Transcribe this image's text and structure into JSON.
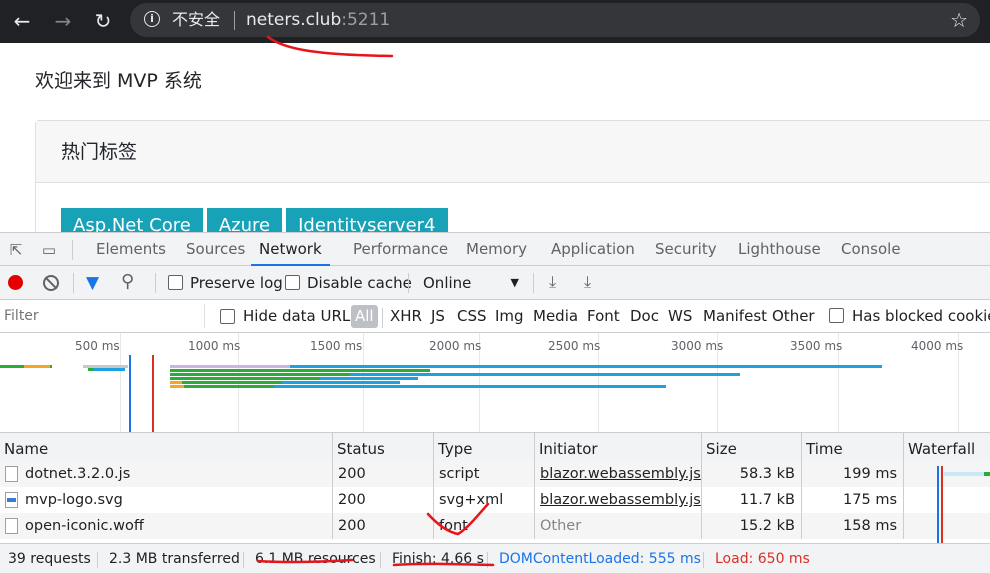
{
  "browser": {
    "security_label": "不安全",
    "url_host": "neters.club",
    "url_port": ":5211"
  },
  "page": {
    "welcome": "欢迎来到 MVP 系统",
    "card_title": "热门标签",
    "tags": [
      "Asp.Net Core",
      "Azure",
      "Identityserver4"
    ]
  },
  "devtools": {
    "tabs": [
      "Elements",
      "Sources",
      "Network",
      "Performance",
      "Memory",
      "Application",
      "Security",
      "Lighthouse",
      "Console"
    ],
    "active_tab": "Network",
    "toolbar": {
      "preserve_log": "Preserve log",
      "disable_cache": "Disable cache",
      "throttle": "Online"
    },
    "filterbar": {
      "placeholder": "Filter",
      "hide_data_urls": "Hide data URLs",
      "types": [
        "All",
        "XHR",
        "JS",
        "CSS",
        "Img",
        "Media",
        "Font",
        "Doc",
        "WS",
        "Manifest",
        "Other"
      ],
      "has_blocked": "Has blocked cookies"
    },
    "overview": {
      "ticks": [
        "500 ms",
        "1000 ms",
        "1500 ms",
        "2000 ms",
        "2500 ms",
        "3000 ms",
        "3500 ms",
        "4000 ms"
      ]
    },
    "columns": [
      "Name",
      "Status",
      "Type",
      "Initiator",
      "Size",
      "Time",
      "Waterfall"
    ],
    "rows": [
      {
        "name": "dotnet.3.2.0.js",
        "status": "200",
        "type": "script",
        "initiator": "blazor.webassembly.js",
        "size": "58.3 kB",
        "time": "199 ms"
      },
      {
        "name": "mvp-logo.svg",
        "status": "200",
        "type": "svg+xml",
        "initiator": "blazor.webassembly.js",
        "size": "11.7 kB",
        "time": "175 ms"
      },
      {
        "name": "open-iconic.woff",
        "status": "200",
        "type": "font",
        "initiator": "Other",
        "size": "15.2 kB",
        "time": "158 ms"
      }
    ],
    "status": {
      "requests": "39 requests",
      "transferred": "2.3 MB transferred",
      "resources": "6.1 MB resources",
      "finish": "Finish: 4.66 s",
      "domcontentloaded": "DOMContentLoaded: 555 ms",
      "load": "Load: 650 ms"
    }
  },
  "colors": {
    "chrome_bg": "#202124",
    "tag_bg": "#17a2b8",
    "accent_blue": "#1a73e8",
    "dcl_blue": "#1a73e8",
    "load_red": "#d93025",
    "annotation_red": "#e8141b"
  }
}
